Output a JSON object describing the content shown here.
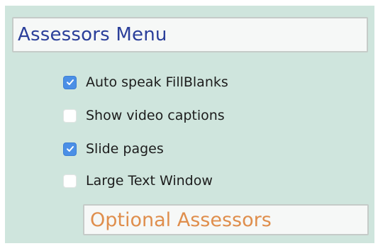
{
  "menu": {
    "title": "Assessors Menu",
    "options": [
      {
        "label": "Auto speak FillBlanks",
        "checked": true
      },
      {
        "label": "Show video captions",
        "checked": false
      },
      {
        "label": "Slide pages",
        "checked": true
      },
      {
        "label": "Large Text Window",
        "checked": false
      }
    ],
    "section_title": "Optional Assessors"
  },
  "colors": {
    "panel_background": "#cfe5dd",
    "title_text": "#2b3f9a",
    "section_text": "#df8e4c",
    "checkbox_checked": "#4b8fe6"
  },
  "icons": {
    "checked": "checkmark-icon"
  }
}
